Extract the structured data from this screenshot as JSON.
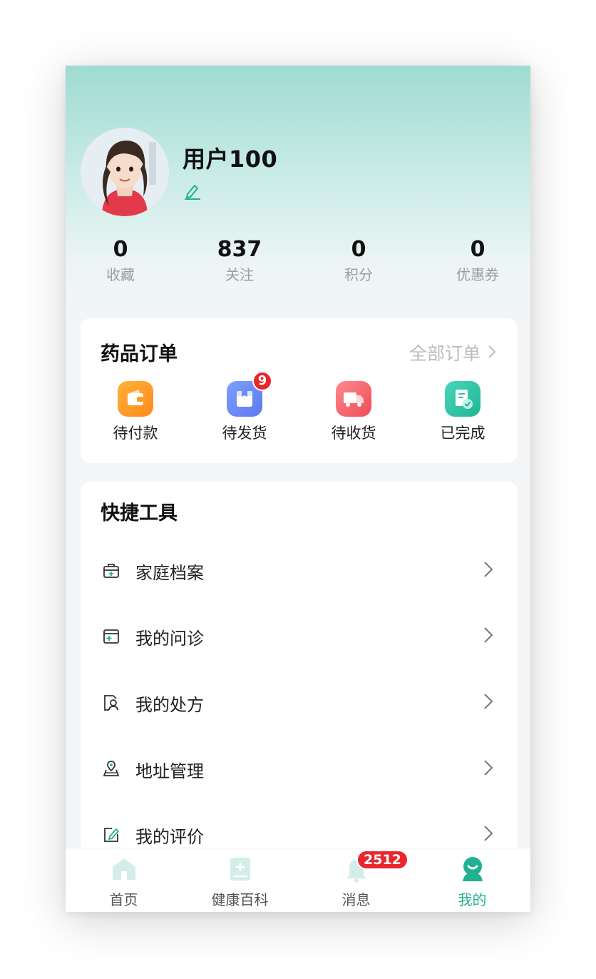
{
  "profile": {
    "username": "用户100"
  },
  "stats": [
    {
      "value": "0",
      "label": "收藏"
    },
    {
      "value": "837",
      "label": "关注"
    },
    {
      "value": "0",
      "label": "积分"
    },
    {
      "value": "0",
      "label": "优惠券"
    }
  ],
  "orders": {
    "title": "药品订单",
    "all_label": "全部订单",
    "items": [
      {
        "label": "待付款",
        "icon": "wallet-icon",
        "color": "#ff9a1f"
      },
      {
        "label": "待发货",
        "icon": "package-icon",
        "color": "#6f8cf5",
        "badge": "9"
      },
      {
        "label": "待收货",
        "icon": "truck-icon",
        "color": "#f2606a"
      },
      {
        "label": "已完成",
        "icon": "completed-doc-icon",
        "color": "#2ec7a8"
      }
    ]
  },
  "tools": {
    "title": "快捷工具",
    "items": [
      {
        "label": "家庭档案",
        "icon": "medical-kit-icon"
      },
      {
        "label": "我的问诊",
        "icon": "consultation-icon"
      },
      {
        "label": "我的处方",
        "icon": "prescription-icon"
      },
      {
        "label": "地址管理",
        "icon": "location-icon"
      },
      {
        "label": "我的评价",
        "icon": "review-edit-icon"
      }
    ]
  },
  "tabbar": {
    "items": [
      {
        "label": "首页",
        "icon": "home-icon"
      },
      {
        "label": "健康百科",
        "icon": "book-icon"
      },
      {
        "label": "消息",
        "icon": "bell-icon",
        "badge": "2512"
      },
      {
        "label": "我的",
        "icon": "profile-icon",
        "active": true
      }
    ]
  },
  "colors": {
    "accent": "#20b290",
    "badge": "#e8262d"
  }
}
